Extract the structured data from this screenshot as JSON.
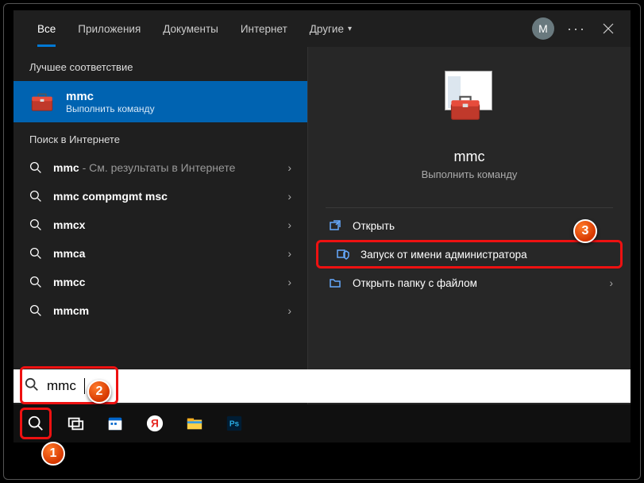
{
  "tabs": {
    "all": "Все",
    "apps": "Приложения",
    "docs": "Документы",
    "web": "Интернет",
    "more": "Другие"
  },
  "avatar_initial": "M",
  "left": {
    "best_header": "Лучшее соответствие",
    "best_title": "mmc",
    "best_sub": "Выполнить команду",
    "web_header": "Поиск в Интернете",
    "items": [
      {
        "bold": "mmc",
        "dim": " - См. результаты в Интернете",
        "arrow": true
      },
      {
        "bold": "mmc compmgmt msc",
        "dim": "",
        "arrow": true
      },
      {
        "bold": "mmcx",
        "dim": "",
        "arrow": true
      },
      {
        "bold": "mmca",
        "dim": "",
        "arrow": true
      },
      {
        "bold": "mmcc",
        "dim": "",
        "arrow": true
      },
      {
        "bold": "mmcm",
        "dim": "",
        "arrow": true
      }
    ]
  },
  "preview": {
    "title": "mmc",
    "sub": "Выполнить команду",
    "actions": {
      "open": "Открыть",
      "admin": "Запуск от имени администратора",
      "folder": "Открыть папку с файлом"
    }
  },
  "search_value": "mmc",
  "annotations": {
    "a1": "1",
    "a2": "2",
    "a3": "3"
  }
}
